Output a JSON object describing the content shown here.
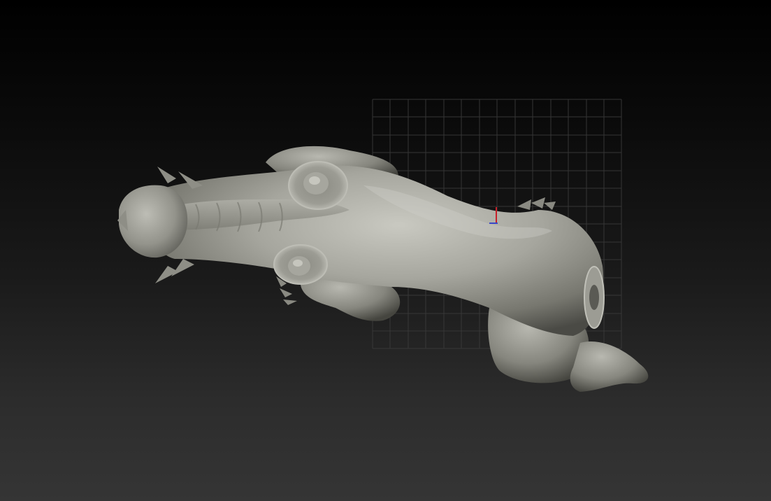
{
  "viewport": {
    "background_top": "#000000",
    "background_bottom": "#353535",
    "grid_color": "#3a3a3a",
    "mesh_color": "#a9a9a0",
    "mesh_shadow": "#55554f",
    "mesh_highlight": "#d4d4cc",
    "axis_y_color": "#c8202a",
    "axis_x_color": "#3a48c8"
  }
}
